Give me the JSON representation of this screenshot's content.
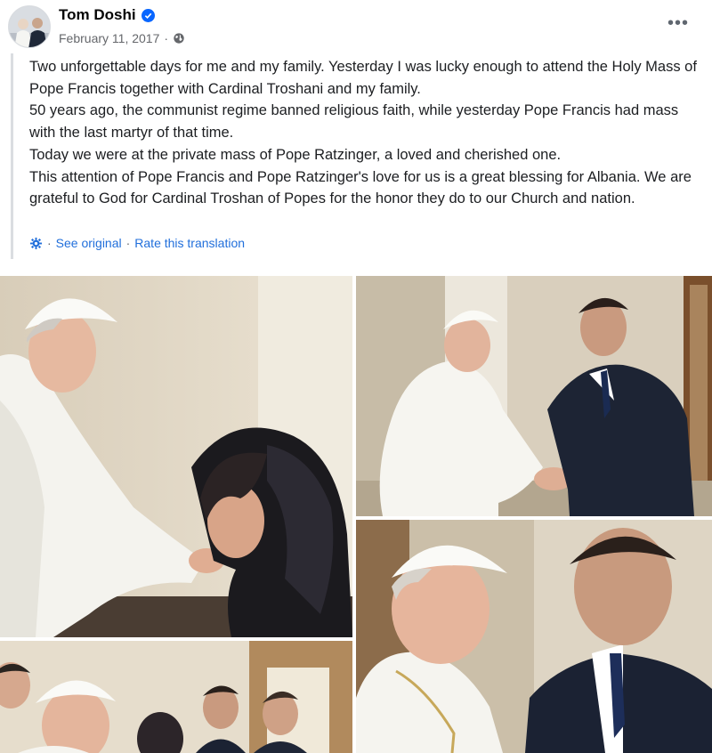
{
  "post": {
    "author": "Tom Doshi",
    "date": "February 11, 2017",
    "separator": "·",
    "more_label": "•••",
    "paragraphs": [
      "Two unforgettable days for me and my family. Yesterday I was lucky enough to attend the Holy Mass of Pope Francis together with Cardinal Troshani and my family.",
      "50 years ago, the communist regime banned religious faith, while yesterday Pope Francis had mass with the last martyr of that time.",
      "Today we were at the private mass of Pope Ratzinger, a loved and cherished one.",
      "This attention of Pope Francis and Pope Ratzinger's love for us is a great blessing for Albania. We are grateful to God for Cardinal Troshan of Popes for the honor they do to our Church and nation."
    ],
    "translation": {
      "see_original": "See original",
      "rate": "Rate this translation",
      "dot": "·"
    }
  },
  "icons": {
    "verified": "verified-badge-icon",
    "audience": "globe-icon",
    "translate": "gear-icon",
    "more": "more-options-icon"
  },
  "colors": {
    "link": "#216fdb",
    "verified": "#0866ff",
    "meta": "#65676b"
  }
}
